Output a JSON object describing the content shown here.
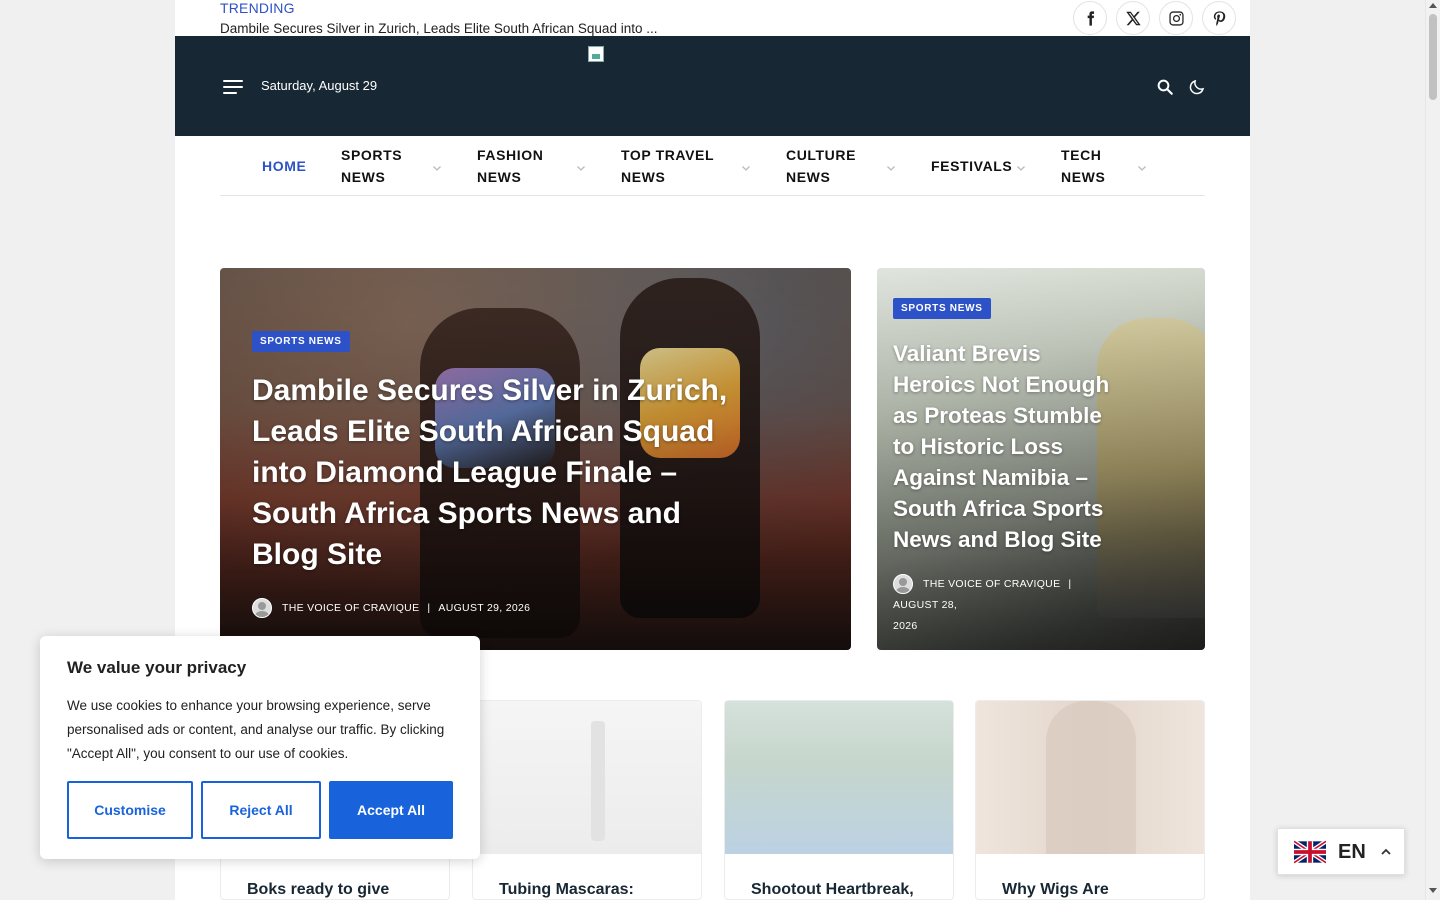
{
  "topbar": {
    "trending_label": "TRENDING",
    "trending_headline": "Dambile Secures Silver in Zurich, Leads Elite South African Squad into ...",
    "social": [
      "facebook-icon",
      "x-icon",
      "instagram-icon",
      "pinterest-icon"
    ]
  },
  "header": {
    "date": "Saturday, August 29",
    "icons": [
      "menu-icon",
      "search-icon",
      "dark-mode-icon"
    ]
  },
  "nav": {
    "items": [
      {
        "label": "HOME",
        "active": true,
        "dropdown": false
      },
      {
        "label": "SPORTS NEWS",
        "line1": "SPORTS",
        "line2": "NEWS",
        "dropdown": true
      },
      {
        "label": "FASHION NEWS",
        "line1": "FASHION",
        "line2": "NEWS",
        "dropdown": true
      },
      {
        "label": "TOP TRAVEL NEWS",
        "line1": "TOP TRAVEL",
        "line2": "NEWS",
        "dropdown": true
      },
      {
        "label": "CULTURE NEWS",
        "line1": "CULTURE",
        "line2": "NEWS",
        "dropdown": true
      },
      {
        "label": "FESTIVALS",
        "dropdown": true
      },
      {
        "label": "TECH NEWS",
        "line1": "TECH",
        "line2": "NEWS",
        "dropdown": true
      }
    ]
  },
  "hero": {
    "category": "SPORTS NEWS",
    "title": "Dambile Secures Silver in Zurich, Leads Elite South African Squad into Diamond League Finale – South Africa Sports News and Blog Site",
    "author": "THE VOICE OF CRAVIQUE",
    "date": "AUGUST 29, 2026"
  },
  "side_post": {
    "category": "SPORTS NEWS",
    "title": "Valiant Brevis Heroics Not Enough as Proteas Stumble to Historic Loss Against Namibia – South Africa Sports News and Blog Site",
    "author": "THE VOICE OF CRAVIQUE",
    "date_line1": "AUGUST 28,",
    "date_line2": "2026"
  },
  "cards": [
    {
      "title": "Boks ready to give"
    },
    {
      "title": "Tubing Mascaras:"
    },
    {
      "title": "Shootout Heartbreak,"
    },
    {
      "title": "Why Wigs Are"
    }
  ],
  "cookie": {
    "heading": "We value your privacy",
    "body": "We use cookies to enhance your browsing experience, serve personalised ads or content, and analyse our traffic. By clicking \"Accept All\", you consent to our use of cookies.",
    "customise": "Customise",
    "reject": "Reject All",
    "accept": "Accept All"
  },
  "language": {
    "code": "EN",
    "flag": "uk-flag-icon"
  },
  "colors": {
    "accent": "#2d52c8",
    "header_bg": "#172733",
    "cookie_button": "#1863dc"
  }
}
